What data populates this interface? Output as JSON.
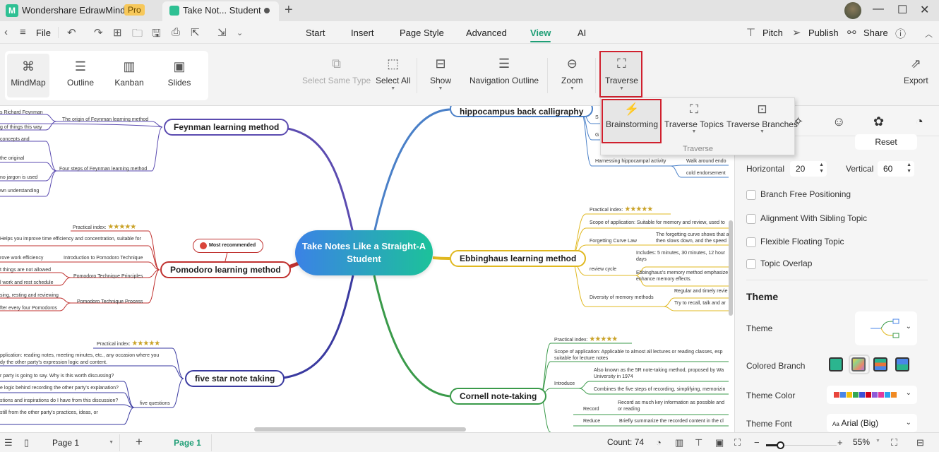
{
  "titlebar": {
    "app_name": "Wondershare EdrawMind",
    "pro_badge": "Pro",
    "doc_tab": "Take Not... Student",
    "new_tab_icon": "+",
    "window_controls": {
      "minimize": "—",
      "maximize": "☐",
      "close": "✕"
    }
  },
  "menubar": {
    "file_label": "File",
    "tabs": [
      {
        "label": "Start"
      },
      {
        "label": "Insert"
      },
      {
        "label": "Page Style"
      },
      {
        "label": "Advanced"
      },
      {
        "label": "View",
        "active": true
      },
      {
        "label": "AI"
      }
    ],
    "right": {
      "pitch": "Pitch",
      "publish": "Publish",
      "share": "Share"
    }
  },
  "ribbon": {
    "views": [
      {
        "label": "MindMap",
        "icon": "⌘",
        "active": true
      },
      {
        "label": "Outline",
        "icon": "☰"
      },
      {
        "label": "Kanban",
        "icon": "▥"
      },
      {
        "label": "Slides",
        "icon": "▣"
      }
    ],
    "select_same_type": "Select Same Type",
    "select_all": "Select All",
    "show": "Show",
    "navigation_outline": "Navigation Outline",
    "zoom": "Zoom",
    "traverse": "Traverse",
    "export": "Export"
  },
  "traverse_popup": {
    "items": [
      {
        "label": "Brainstorming",
        "icon": "💡",
        "highlighted": true
      },
      {
        "label": "Traverse Topics",
        "icon": "▣"
      },
      {
        "label": "Traverse Branches",
        "icon": "⊡"
      }
    ],
    "group_label": "Traverse"
  },
  "mindmap": {
    "center": "Take Notes Like a Straight-A Student",
    "callout": "Most recommended",
    "branches": {
      "feynman": {
        "title": "Feynman learning method",
        "color": "#5b4bb0",
        "subtopics": [
          "The origin of Feynman learning method",
          "Four steps of Feynman learning method"
        ],
        "leaves": [
          "s Richard Feynman",
          "g of things this way",
          "concepts and",
          "the original",
          "no jargon is used",
          "wn understanding"
        ]
      },
      "pomodoro": {
        "title": "Pomodoro learning method",
        "color": "#c0312f",
        "practical_index": "Practical index:",
        "stars": "★★★★★",
        "subtopics": [
          "Introduction to Pomodoro Technique",
          "Pomodoro Technique Principles",
          "Pomodoro Technique Process"
        ],
        "leaves": [
          "Helps you improve time efficiency and concentration, suitable for",
          "rove work efficiency",
          "t things are not allowed",
          "l work and rest schedule",
          "sing, resting and reviewing",
          "fter every four Pomodoros"
        ]
      },
      "five_star": {
        "title": "five star note taking",
        "color": "#3a3aa0",
        "practical_index": "Practical index:",
        "stars": "★★★★★",
        "subtopics": [
          "five questions"
        ],
        "leaves": [
          "pplication: reading notes, meeting minutes, etc., any occasion where you",
          "dy the other party's expression logic and content.",
          "r party is going to say. Why is this worth discussing?",
          "e logic behind recording the other party's explanation?",
          "stions and inspirations do I have from this discussion?",
          "still from the other party's practices, ideas, or"
        ]
      },
      "hippocampus": {
        "title": "hippocampus back calligraphy",
        "color": "#4a80c8",
        "subtopics": [
          "S",
          "G",
          "Harnessing hippocampal activity"
        ],
        "leaves": [
          "Walk around endo",
          "cold endorsement"
        ]
      },
      "ebbinghaus": {
        "title": "Ebbinghaus learning method",
        "color": "#e0b820",
        "practical_index": "Practical index:",
        "stars": "★★★★★",
        "subtopics": [
          "Scope of application: Suitable for memory and review, used to",
          "Forgetting Curve Law",
          "review cycle",
          "Diversity of memory methods"
        ],
        "leaves": [
          "The forgetting curve shows that a",
          "then slows down, and the speed",
          "Includes: 5 minutes, 30 minutes, 12 hour",
          "days",
          "Ebbinghaus's memory method emphasize",
          "enhance memory effects.",
          "Regular and timely revie",
          "Try to recall, talk and ar"
        ]
      },
      "cornell": {
        "title": "Cornell note-taking",
        "color": "#3a9a4a",
        "practical_index": "Practical index:",
        "stars": "★★★★★",
        "subtopics": [
          "Scope of application: Applicable to almost all lectures or reading classes, esp",
          "suitable for lecture notes",
          "Introduce",
          "Record",
          "Reduce"
        ],
        "leaves": [
          "Also known as the 5R note-taking method, proposed by Wa",
          "University in 1974",
          "Combines the five steps of recording, simplifying, memorizin",
          "Record as much key information as possible and",
          "or reading",
          "Briefly summarize the recorded content in the cl"
        ]
      }
    }
  },
  "panel": {
    "reset": "Reset",
    "horizontal_label": "Horizontal",
    "horizontal_value": "20",
    "vertical_label": "Vertical",
    "vertical_value": "60",
    "checkboxes": [
      {
        "label": "Branch Free Positioning",
        "checked": false
      },
      {
        "label": "Alignment With Sibling Topic",
        "checked": false
      },
      {
        "label": "Flexible Floating Topic",
        "checked": false
      },
      {
        "label": "Topic Overlap",
        "checked": false
      }
    ],
    "theme_section": "Theme",
    "theme_label": "Theme",
    "colored_branch_label": "Colored Branch",
    "theme_color_label": "Theme Color",
    "theme_colors": [
      "#e8453c",
      "#4a86e8",
      "#f4c20d",
      "#34a853",
      "#3c4fd8",
      "#d0021b",
      "#8e5bd8",
      "#e03a9c",
      "#2aa3f0",
      "#f08a24"
    ],
    "theme_font_label": "Theme Font",
    "theme_font_value": "Arial (Big)",
    "theme_font_prefix": "Aa"
  },
  "statusbar": {
    "page_select": "Page 1",
    "page_tab": "Page 1",
    "count": "Count: 74",
    "zoom_level": "55%",
    "zoom_fraction": 0.2
  }
}
